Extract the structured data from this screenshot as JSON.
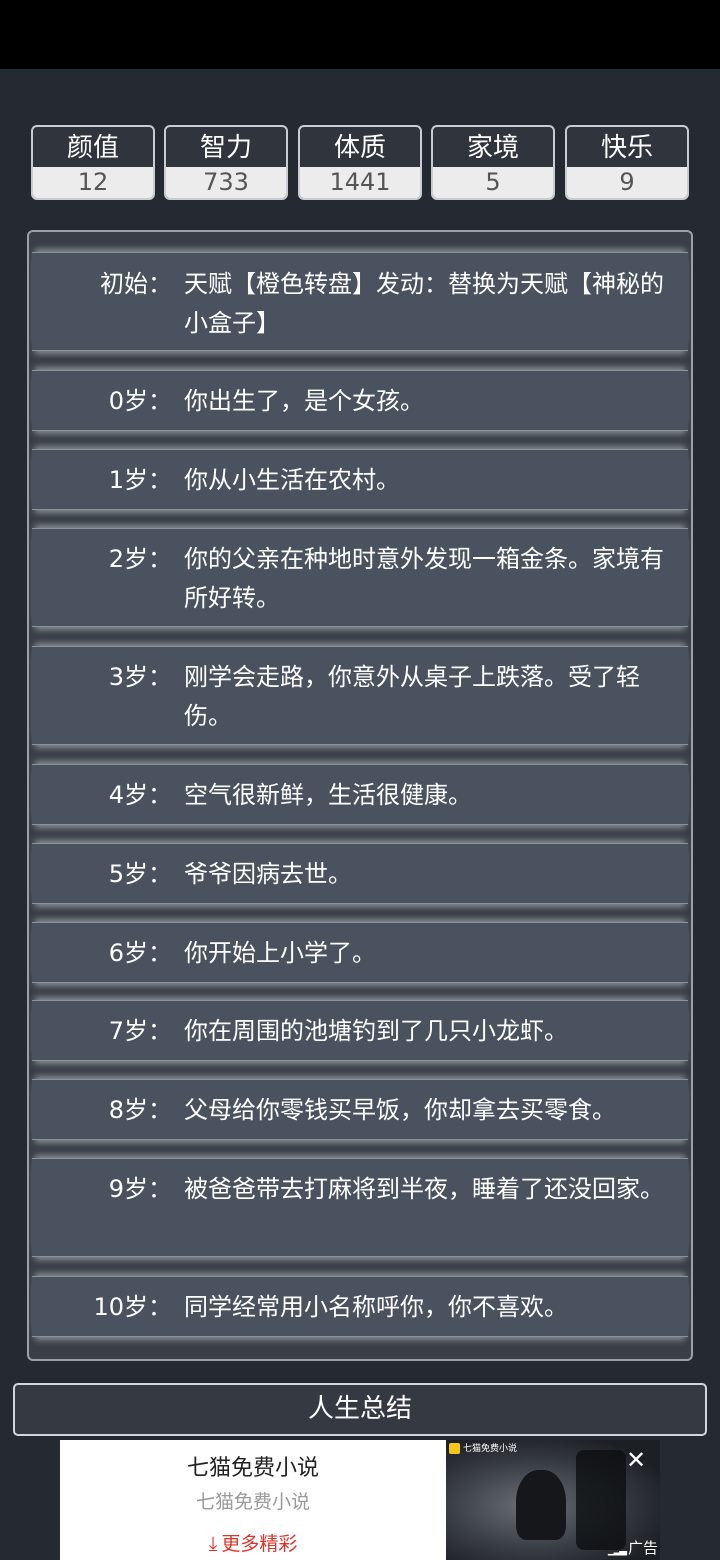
{
  "stats": [
    {
      "label": "颜值",
      "value": "12"
    },
    {
      "label": "智力",
      "value": "733"
    },
    {
      "label": "体质",
      "value": "1441"
    },
    {
      "label": "家境",
      "value": "5"
    },
    {
      "label": "快乐",
      "value": "9"
    }
  ],
  "log": [
    {
      "age": "初始：",
      "text": "天赋【橙色转盘】发动：替换为天赋【神秘的小盒子】"
    },
    {
      "age": "0岁：",
      "text": "你出生了，是个女孩。"
    },
    {
      "age": "1岁：",
      "text": "你从小生活在农村。"
    },
    {
      "age": "2岁：",
      "text": "你的父亲在种地时意外发现一箱金条。家境有所好转。"
    },
    {
      "age": "3岁：",
      "text": "刚学会走路，你意外从桌子上跌落。受了轻伤。"
    },
    {
      "age": "4岁：",
      "text": "空气很新鲜，生活很健康。"
    },
    {
      "age": "5岁：",
      "text": "爷爷因病去世。"
    },
    {
      "age": "6岁：",
      "text": "你开始上小学了。"
    },
    {
      "age": "7岁：",
      "text": "你在周围的池塘钓到了几只小龙虾。"
    },
    {
      "age": "8岁：",
      "text": "父母给你零钱买早饭，你却拿去买零食。"
    },
    {
      "age": "9岁：",
      "text": "被爸爸带去打麻将到半夜，睡着了还没回家。"
    },
    {
      "age": "10岁：",
      "text": "同学经常用小名称呼你，你不喜欢。"
    }
  ],
  "summary_button": "人生总结",
  "ad": {
    "title": "七猫免费小说",
    "subtitle": "七猫免费小说",
    "cta": "更多精彩",
    "brand": "七猫免费小说",
    "label": "广告",
    "close_icon": "close-icon"
  }
}
